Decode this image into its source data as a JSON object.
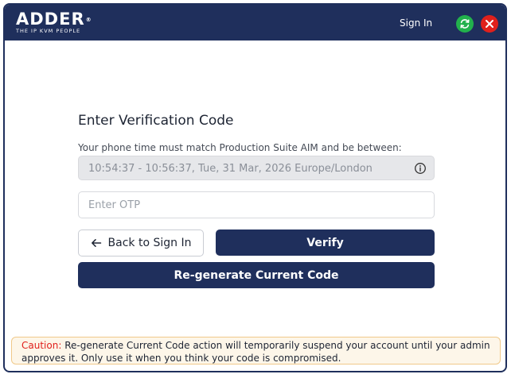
{
  "brand": {
    "name": "ADDER",
    "registered": "®",
    "tagline": "THE IP KVM PEOPLE"
  },
  "header": {
    "signin_label": "Sign In",
    "refresh_icon": "refresh-icon",
    "close_icon": "close-icon"
  },
  "form": {
    "title": "Enter Verification Code",
    "time_info": "Your phone time must match Production Suite AIM and be between:",
    "time_range": "10:54:37 - 10:56:37, Tue, 31 Mar, 2026 Europe/London",
    "otp_placeholder": "Enter OTP",
    "otp_value": "",
    "back_label": "Back to Sign In",
    "verify_label": "Verify",
    "regenerate_label": "Re-generate Current Code"
  },
  "caution": {
    "label": "Caution:",
    "text": "Re-generate Current Code action will  temporarily suspend your account until your admin approves it. Only use it when you think your code is compromised."
  },
  "colors": {
    "primary": "#1f2f5c",
    "refresh": "#22b14c",
    "close": "#e0201c",
    "caution_bg": "#fdf6e9",
    "caution_border": "#f0c98a"
  }
}
